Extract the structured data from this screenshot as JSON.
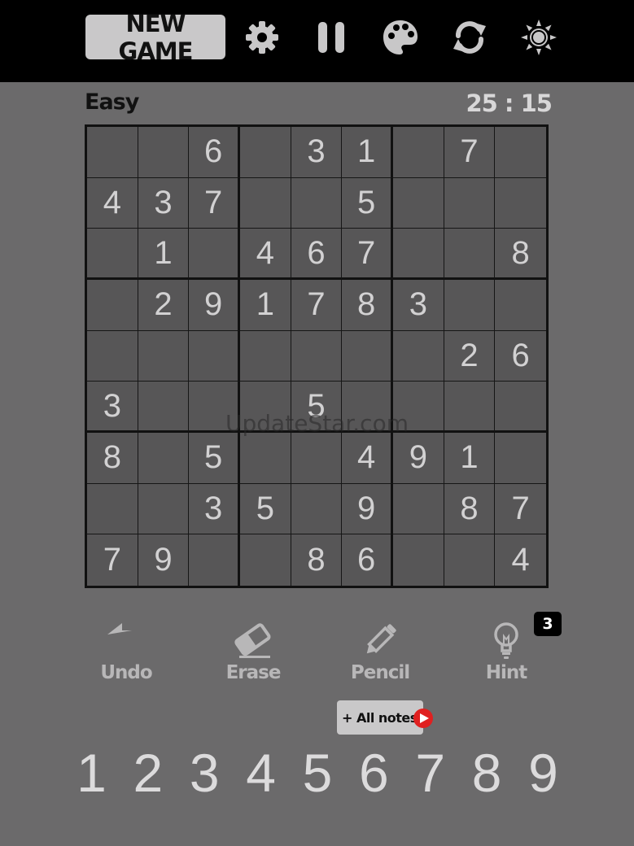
{
  "header": {
    "new_game_label": "NEW GAME",
    "icons": [
      "gear-icon",
      "pause-icon",
      "palette-icon",
      "refresh-icon",
      "sun-icon"
    ]
  },
  "status": {
    "difficulty": "Easy",
    "timer": "25 : 15"
  },
  "board": [
    [
      "",
      "",
      "6",
      "",
      "3",
      "1",
      "",
      "7",
      ""
    ],
    [
      "4",
      "3",
      "7",
      "",
      "",
      "5",
      "",
      "",
      ""
    ],
    [
      "",
      "1",
      "",
      "4",
      "6",
      "7",
      "",
      "",
      "8"
    ],
    [
      "",
      "2",
      "9",
      "1",
      "7",
      "8",
      "3",
      "",
      ""
    ],
    [
      "",
      "",
      "",
      "",
      "",
      "",
      "",
      "2",
      "6"
    ],
    [
      "3",
      "",
      "",
      "",
      "5",
      "",
      "",
      "",
      ""
    ],
    [
      "8",
      "",
      "5",
      "",
      "",
      "4",
      "9",
      "1",
      ""
    ],
    [
      "",
      "",
      "3",
      "5",
      "",
      "9",
      "",
      "8",
      "7"
    ],
    [
      "7",
      "9",
      "",
      "",
      "8",
      "6",
      "",
      "",
      "4"
    ]
  ],
  "watermark": "UpdateStar.com",
  "tools": {
    "undo": "Undo",
    "erase": "Erase",
    "pencil": "Pencil",
    "hint": "Hint",
    "hint_count": "3"
  },
  "all_notes_label": "+ All notes",
  "numpad": [
    "1",
    "2",
    "3",
    "4",
    "5",
    "6",
    "7",
    "8",
    "9"
  ],
  "colors": {
    "background": "#6b6a6b",
    "topbar": "#000000",
    "cell": "#575657",
    "digit": "#d2d1d2",
    "button": "#c9c8c9"
  }
}
